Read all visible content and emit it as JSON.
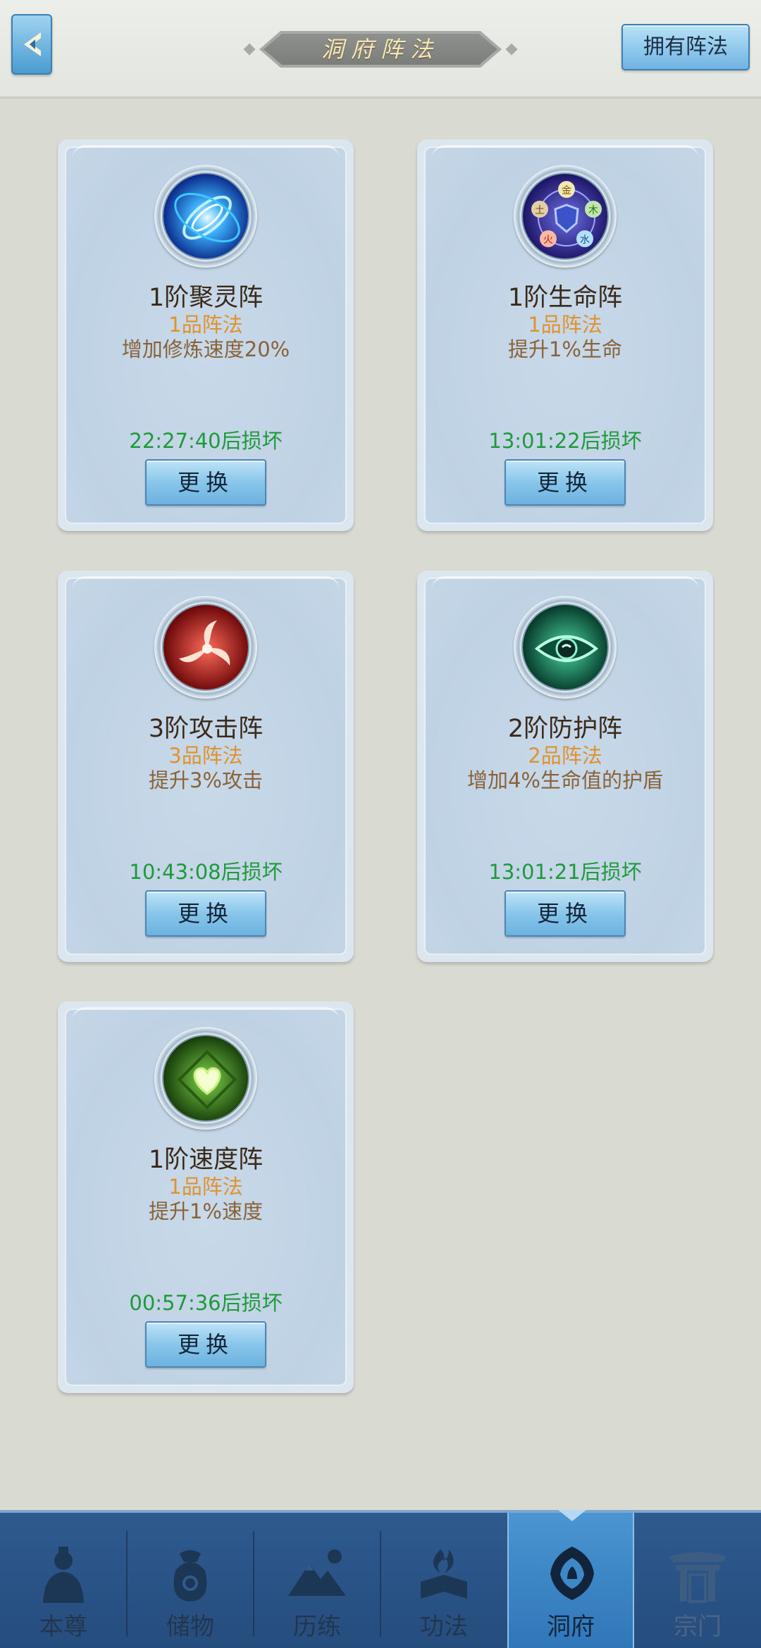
{
  "header": {
    "title": "洞府阵法",
    "owned_button": "拥有阵法"
  },
  "cards": [
    {
      "name": "1阶聚灵阵",
      "grade": "1品阵法",
      "effect": "增加修炼速度20%",
      "timer": "22:27:40后损坏",
      "button": "更换",
      "icon": "swirl-vortex-icon"
    },
    {
      "name": "1阶生命阵",
      "grade": "1品阵法",
      "effect": "提升1%生命",
      "timer": "13:01:22后损坏",
      "button": "更换",
      "icon": "five-elements-icon",
      "elements": [
        "金",
        "木",
        "水",
        "火",
        "土"
      ]
    },
    {
      "name": "3阶攻击阵",
      "grade": "3品阵法",
      "effect": "提升3%攻击",
      "timer": "10:43:08后损坏",
      "button": "更换",
      "icon": "blade-spin-icon"
    },
    {
      "name": "2阶防护阵",
      "grade": "2品阵法",
      "effect": "增加4%生命值的护盾",
      "timer": "13:01:21后损坏",
      "button": "更换",
      "icon": "eye-shield-icon"
    },
    {
      "name": "1阶速度阵",
      "grade": "1品阵法",
      "effect": "提升1%速度",
      "timer": "00:57:36后损坏",
      "button": "更换",
      "icon": "heart-icon"
    }
  ],
  "nav": [
    {
      "label": "本尊",
      "icon": "character-icon",
      "active": false
    },
    {
      "label": "储物",
      "icon": "storage-bag-icon",
      "active": false
    },
    {
      "label": "历练",
      "icon": "mountain-icon",
      "active": false
    },
    {
      "label": "功法",
      "icon": "scroll-book-icon",
      "active": false
    },
    {
      "label": "洞府",
      "icon": "cave-dwelling-icon",
      "active": true
    },
    {
      "label": "宗门",
      "icon": "sect-gate-icon",
      "active": false
    }
  ],
  "colors": {
    "grade": "#e0922c",
    "effect": "#8a6238",
    "timer": "#1f9a3a",
    "nav_bg": "#2f5a8e",
    "nav_active": "#4a95d2"
  }
}
